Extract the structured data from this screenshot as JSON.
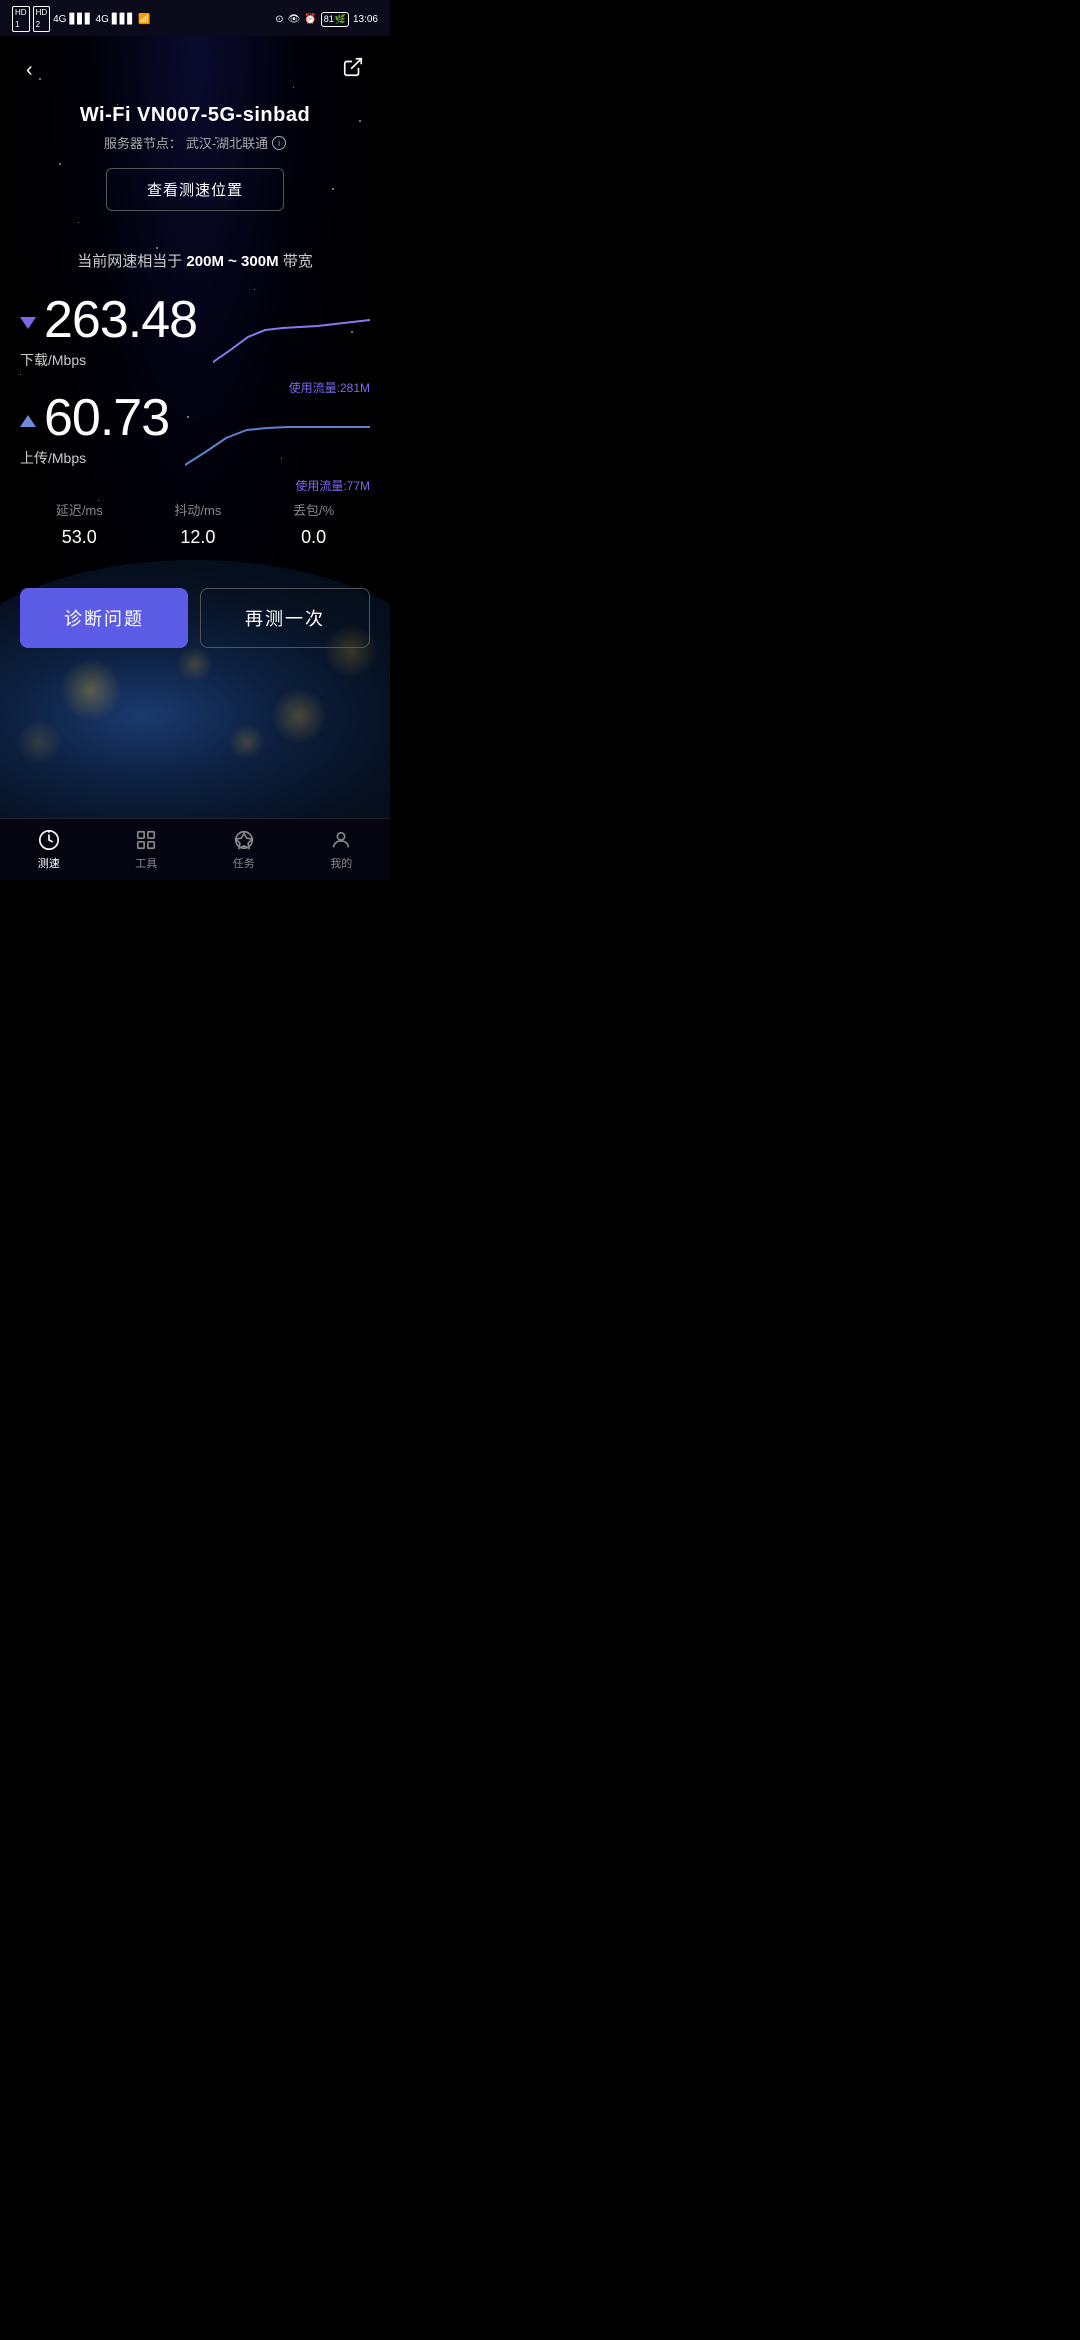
{
  "statusBar": {
    "time": "13:06",
    "battery": "81",
    "hd1": "HD1",
    "hd2": "HD2",
    "signal": "4G"
  },
  "header": {
    "back": "‹",
    "share": "⬡"
  },
  "wifi": {
    "name": "Wi-Fi VN007-5G-sinbad",
    "server_prefix": "服务器节点：",
    "server_name": "武汉-湖北联通",
    "location_btn": "查看测速位置"
  },
  "speedSummary": {
    "prefix": "当前网速相当于",
    "range": "200M ~ 300M",
    "suffix": "带宽"
  },
  "download": {
    "value": "263.48",
    "unit": "下载/Mbps",
    "traffic_label": "使用流量:281M"
  },
  "upload": {
    "value": "60.73",
    "unit": "上传/Mbps",
    "traffic_label": "使用流量:77M"
  },
  "stats": {
    "latency_label": "延迟/ms",
    "latency_value": "53.0",
    "jitter_label": "抖动/ms",
    "jitter_value": "12.0",
    "packetloss_label": "丢包/%",
    "packetloss_value": "0.0"
  },
  "buttons": {
    "diagnose": "诊断问题",
    "retest": "再测一次"
  },
  "nav": {
    "items": [
      {
        "label": "测速",
        "active": true
      },
      {
        "label": "工具",
        "active": false
      },
      {
        "label": "任务",
        "active": false
      },
      {
        "label": "我的",
        "active": false
      }
    ]
  }
}
